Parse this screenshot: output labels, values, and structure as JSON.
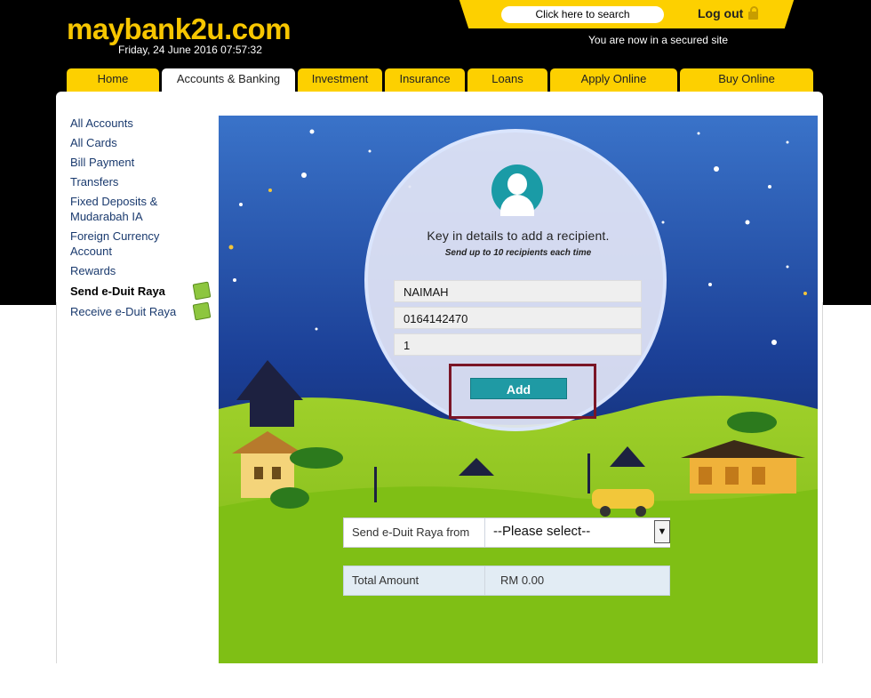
{
  "header": {
    "logo": "maybank2u.com",
    "datetime": "Friday, 24 June 2016 07:57:32",
    "search_placeholder": "Click here to search",
    "logout_label": "Log out",
    "secured_text": "You are now in a secured site"
  },
  "tabs": [
    {
      "label": "Home"
    },
    {
      "label": "Accounts & Banking",
      "active": true
    },
    {
      "label": "Investment"
    },
    {
      "label": "Insurance"
    },
    {
      "label": "Loans"
    },
    {
      "label": "Apply Online"
    },
    {
      "label": "Buy Online"
    }
  ],
  "sidebar": {
    "items": [
      {
        "label": "All Accounts"
      },
      {
        "label": "All Cards"
      },
      {
        "label": "Bill Payment"
      },
      {
        "label": "Transfers"
      },
      {
        "label": "Fixed Deposits & Mudarabah IA"
      },
      {
        "label": "Foreign Currency Account"
      },
      {
        "label": "Rewards"
      },
      {
        "label": "Send e-Duit Raya",
        "active": true
      },
      {
        "label": "Receive e-Duit Raya"
      }
    ]
  },
  "form": {
    "heading": "Key in details to add a recipient.",
    "subheading": "Send up to 10 recipients each time",
    "name_value": "NAIMAH",
    "phone_value": "0164142470",
    "amount_value": "1",
    "add_label": "Add",
    "send_from_label": "Send e-Duit Raya from",
    "send_from_selected": "--Please select--",
    "total_label": "Total Amount",
    "total_value": "RM 0.00"
  },
  "colors": {
    "brand_yellow": "#fdd000",
    "teal": "#1f9aa4",
    "highlight": "#7a1526",
    "sky": "#1f4aa0",
    "grass": "#8cc320"
  }
}
